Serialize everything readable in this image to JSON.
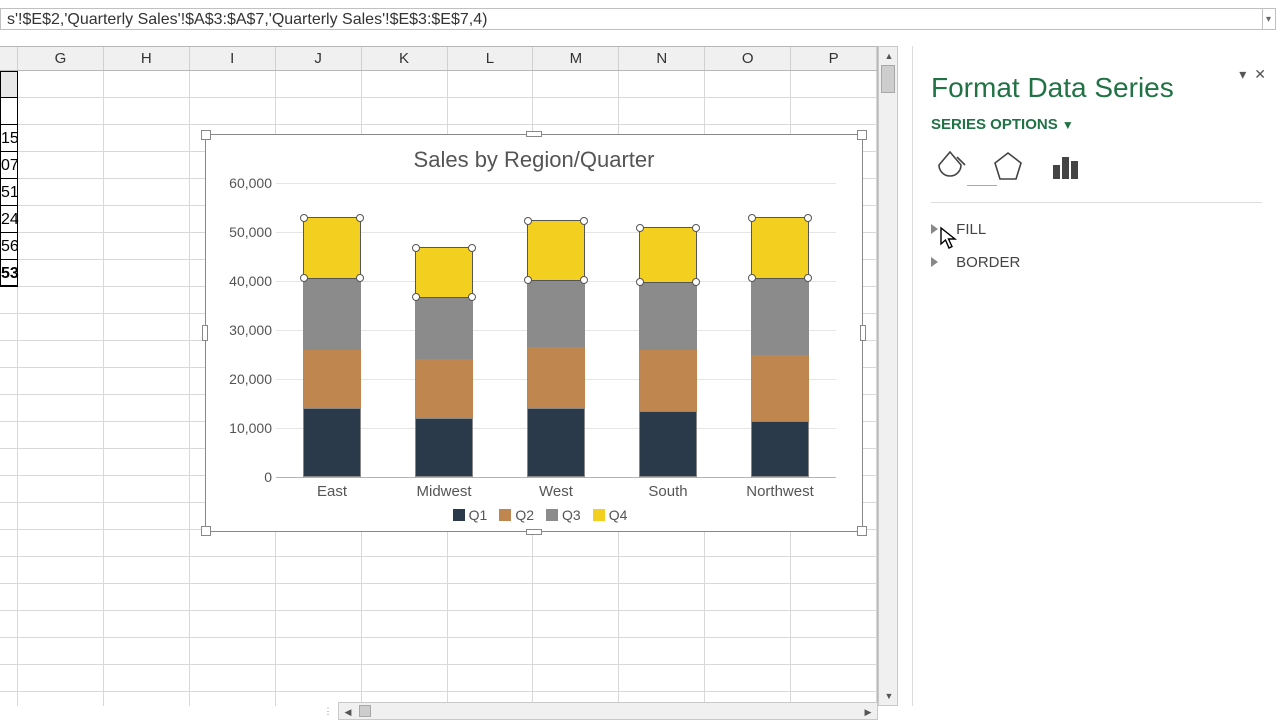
{
  "formula": "s'!$E$2,'Quarterly Sales'!$A$3:$A$7,'Quarterly Sales'!$E$3:$E$7,4)",
  "columns": [
    "G",
    "H",
    "I",
    "J",
    "K",
    "L",
    "M",
    "N",
    "O",
    "P"
  ],
  "partial_col_values": [
    "",
    "15",
    "07",
    "51",
    "24",
    "56",
    "53"
  ],
  "panel": {
    "title": "Format Data Series",
    "section": "SERIES OPTIONS",
    "fill_label": "FILL",
    "border_label": "BORDER"
  },
  "chart_data": {
    "type": "bar-stacked",
    "title": "Sales by Region/Quarter",
    "categories": [
      "East",
      "Midwest",
      "West",
      "South",
      "Northwest"
    ],
    "series": [
      {
        "name": "Q1",
        "color": "#2b3a4a",
        "values": [
          14000,
          12000,
          14000,
          13500,
          11500
        ]
      },
      {
        "name": "Q2",
        "color": "#c08650",
        "values": [
          12000,
          12000,
          12500,
          12500,
          13500
        ]
      },
      {
        "name": "Q3",
        "color": "#8b8b8b",
        "values": [
          14500,
          12500,
          13500,
          13500,
          15500
        ]
      },
      {
        "name": "Q4",
        "color": "#f3cf1f",
        "values": [
          12500,
          10500,
          12500,
          11500,
          12500
        ]
      }
    ],
    "ylabel": "",
    "xlabel": "",
    "ylim": [
      0,
      60000
    ],
    "yticks": [
      0,
      10000,
      20000,
      30000,
      40000,
      50000,
      60000
    ],
    "ytick_labels": [
      "0",
      "10,000",
      "20,000",
      "30,000",
      "40,000",
      "50,000",
      "60,000"
    ]
  }
}
